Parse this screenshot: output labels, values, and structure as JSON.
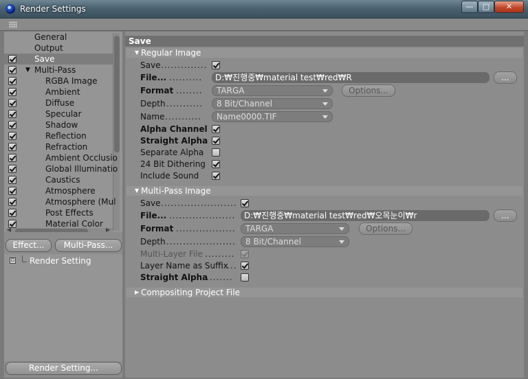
{
  "window": {
    "title": "Render Settings",
    "controls": {
      "minimize": "—",
      "maximize": "□",
      "close": "✕"
    }
  },
  "sidebar": {
    "items": [
      {
        "label": "General",
        "checked": null,
        "indent": 1
      },
      {
        "label": "Output",
        "checked": null,
        "indent": 1
      },
      {
        "label": "Save",
        "checked": true,
        "indent": 1,
        "selected": true
      },
      {
        "label": "Multi-Pass",
        "checked": true,
        "indent": 1,
        "expandable": true
      },
      {
        "label": "RGBA Image",
        "checked": true,
        "indent": 2
      },
      {
        "label": "Ambient",
        "checked": true,
        "indent": 2
      },
      {
        "label": "Diffuse",
        "checked": true,
        "indent": 2
      },
      {
        "label": "Specular",
        "checked": true,
        "indent": 2
      },
      {
        "label": "Shadow",
        "checked": true,
        "indent": 2
      },
      {
        "label": "Reflection",
        "checked": true,
        "indent": 2
      },
      {
        "label": "Refraction",
        "checked": true,
        "indent": 2
      },
      {
        "label": "Ambient Occlusio",
        "checked": true,
        "indent": 2
      },
      {
        "label": "Global Illuminatio",
        "checked": true,
        "indent": 2
      },
      {
        "label": "Caustics",
        "checked": true,
        "indent": 2
      },
      {
        "label": "Atmosphere",
        "checked": true,
        "indent": 2
      },
      {
        "label": "Atmosphere (Mul",
        "checked": true,
        "indent": 2
      },
      {
        "label": "Post Effects",
        "checked": true,
        "indent": 2
      },
      {
        "label": "Material Color",
        "checked": true,
        "indent": 2
      }
    ],
    "effect_button": "Effect...",
    "multipass_button": "Multi-Pass...",
    "preset_label": "Render Setting",
    "render_setting_button": "Render Setting..."
  },
  "main": {
    "header": "Save",
    "regular": {
      "title": "Regular Image",
      "save_label": "Save",
      "save_checked": true,
      "file_label": "File...",
      "file_path": "D:₩진행중₩material test₩red₩R",
      "browse": "...",
      "format_label": "Format",
      "format_value": "TARGA",
      "options_button": "Options...",
      "depth_label": "Depth",
      "depth_value": "8 Bit/Channel",
      "name_label": "Name",
      "name_value": "Name0000.TIF",
      "alpha_label": "Alpha Channel",
      "alpha_checked": true,
      "straight_label": "Straight Alpha",
      "straight_checked": true,
      "separate_label": "Separate Alpha",
      "separate_checked": false,
      "dither_label": "24 Bit Dithering",
      "dither_checked": true,
      "sound_label": "Include Sound",
      "sound_checked": true
    },
    "multipass": {
      "title": "Multi-Pass Image",
      "save_label": "Save",
      "save_checked": true,
      "file_label": "File...",
      "file_path": "D:₩진행중₩material test₩red₩오목눈이₩r",
      "browse": "...",
      "format_label": "Format",
      "format_value": "TARGA",
      "options_button": "Options...",
      "depth_label": "Depth",
      "depth_value": "8 Bit/Channel",
      "multilayer_label": "Multi-Layer File",
      "multilayer_checked": true,
      "suffix_label": "Layer Name as Suffix",
      "suffix_checked": true,
      "straight_label": "Straight Alpha",
      "straight_checked": false
    },
    "compositing": {
      "title": "Compositing Project File"
    }
  }
}
